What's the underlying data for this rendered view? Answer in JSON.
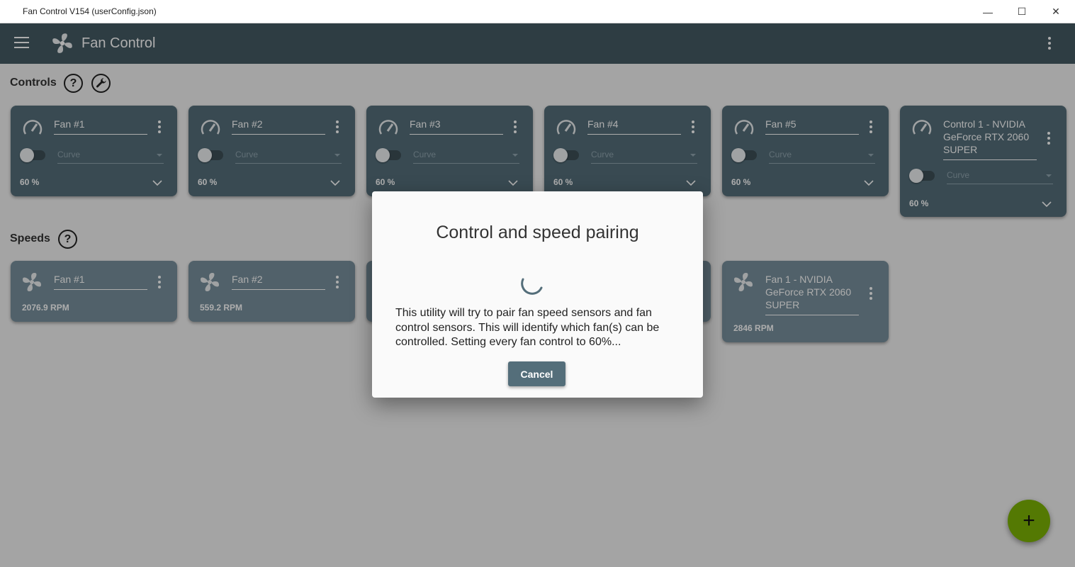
{
  "window": {
    "title": "Fan Control V154 (userConfig.json)",
    "minimize_glyph": "—",
    "maximize_glyph": "☐",
    "close_glyph": "✕"
  },
  "appbar": {
    "title": "Fan Control",
    "menu_icon": "hamburger-menu-icon",
    "logo_icon": "fan-logo-icon",
    "more_icon": "more-vertical-icon"
  },
  "controls": {
    "title": "Controls",
    "help_label": "?",
    "cards": [
      {
        "name": "Fan #1",
        "mode": "Curve",
        "percent": "60 %"
      },
      {
        "name": "Fan #2",
        "mode": "Curve",
        "percent": "60 %"
      },
      {
        "name": "Fan #3",
        "mode": "Curve",
        "percent": "60 %"
      },
      {
        "name": "Fan #4",
        "mode": "Curve",
        "percent": "60 %"
      },
      {
        "name": "Fan #5",
        "mode": "Curve",
        "percent": "60 %"
      },
      {
        "name": "Control 1 - NVIDIA GeForce RTX 2060 SUPER",
        "mode": "Curve",
        "percent": "60 %"
      }
    ]
  },
  "speeds": {
    "title": "Speeds",
    "help_label": "?",
    "cards": [
      {
        "name": "Fan #1",
        "rpm": "2076.9 RPM"
      },
      {
        "name": "Fan #2",
        "rpm": "559.2 RPM"
      },
      {
        "name": "Fan 1 - NVIDIA GeForce RTX 2060 SUPER",
        "rpm": "2846 RPM"
      }
    ]
  },
  "dialog": {
    "title": "Control and speed pairing",
    "text": "This utility will try to pair fan speed sensors and fan control sensors. This will identify which fan(s) can be controlled. Setting every fan control to 60%...",
    "cancel_label": "Cancel"
  },
  "fab": {
    "label": "+"
  },
  "colors": {
    "appbar": "#455a64",
    "control_card": "#546e7a",
    "speed_card": "#78909c",
    "fab": "#7cb305"
  }
}
